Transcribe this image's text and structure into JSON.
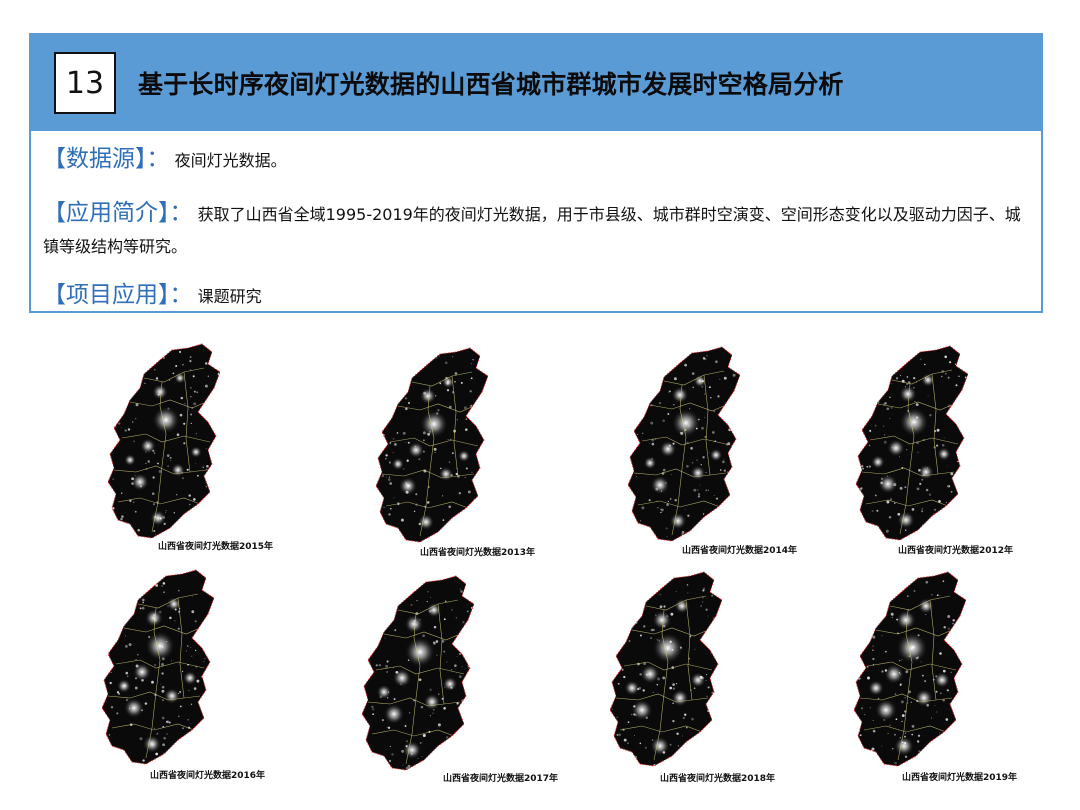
{
  "panel": {
    "number": "13",
    "title": "基于长时序夜间灯光数据的山西省城市群城市发展时空格局分析",
    "rows": [
      {
        "label": "【数据源】：",
        "text": "夜间灯光数据。"
      },
      {
        "label": "【应用简介】：",
        "text": "获取了山西省全域1995-2019年的夜间灯光数据，用于市县级、城市群时空演变、空间形态变化以及驱动力因子、城镇等级结构等研究。"
      },
      {
        "label": "【项目应用】：",
        "text": "课题研究"
      }
    ]
  },
  "maps": [
    {
      "caption": "山西省夜间灯光数据2015年"
    },
    {
      "caption": "山西省夜间灯光数据2013年"
    },
    {
      "caption": "山西省夜间灯光数据2014年"
    },
    {
      "caption": "山西省夜间灯光数据2012年"
    },
    {
      "caption": "山西省夜间灯光数据2016年"
    },
    {
      "caption": "山西省夜间灯光数据2017年"
    },
    {
      "caption": "山西省夜间灯光数据2018年"
    },
    {
      "caption": "山西省夜间灯光数据2019年"
    }
  ],
  "colors": {
    "accent": "#5b9bd5",
    "label": "#2f6fb7",
    "map_bg": "#0a0a0a",
    "boundary": "#d9d27a",
    "outline": "#e0262b"
  }
}
